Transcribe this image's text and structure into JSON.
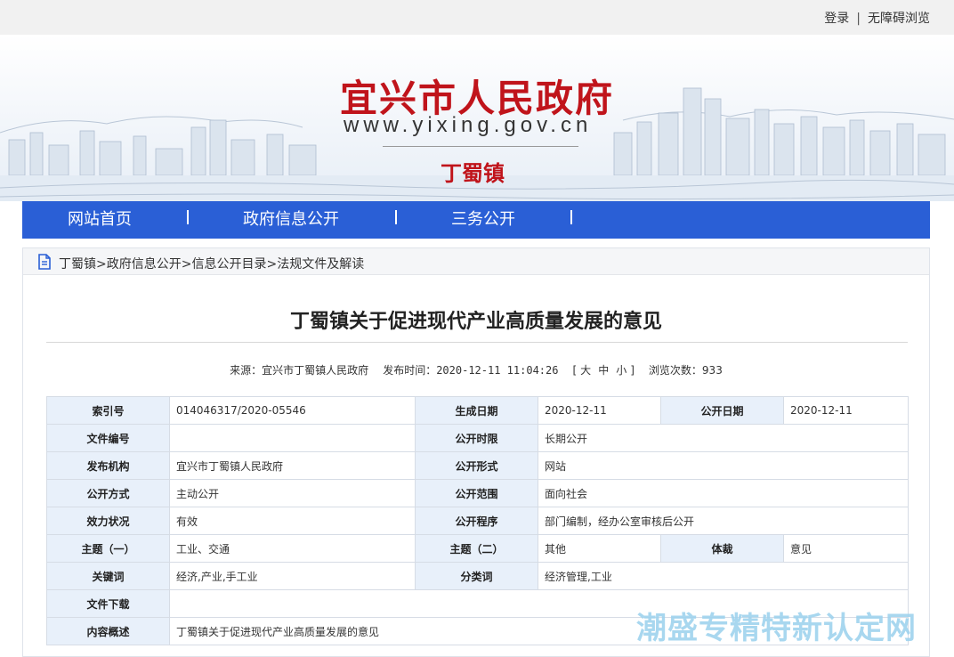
{
  "topbar": {
    "login": "登录",
    "separator": "|",
    "accessibility": "无障碍浏览"
  },
  "banner": {
    "title": "宜兴市人民政府",
    "url": "www.yixing.gov.cn",
    "town": "丁蜀镇"
  },
  "nav": {
    "items": [
      {
        "label": "网站首页"
      },
      {
        "label": "政府信息公开"
      },
      {
        "label": "三务公开"
      }
    ]
  },
  "breadcrumb": {
    "items": [
      "丁蜀镇",
      "政府信息公开",
      "信息公开目录",
      "法规文件及解读"
    ],
    "separator": ">"
  },
  "document": {
    "title": "丁蜀镇关于促进现代产业高质量发展的意见",
    "source_label": "来源：",
    "source": "宜兴市丁蜀镇人民政府",
    "publish_label": "发布时间：",
    "publish_time": "2020-12-11 11:04:26",
    "size_open": "[",
    "size_large": "大",
    "size_medium": "中",
    "size_small": "小",
    "size_close": "]",
    "views_label": "浏览次数：",
    "views": "933"
  },
  "info": {
    "index_no_label": "索引号",
    "index_no": "014046317/2020-05546",
    "gen_date_label": "生成日期",
    "gen_date": "2020-12-11",
    "pub_date_label": "公开日期",
    "pub_date": "2020-12-11",
    "doc_no_label": "文件编号",
    "doc_no": "",
    "pub_limit_label": "公开时限",
    "pub_limit": "长期公开",
    "issuer_label": "发布机构",
    "issuer": "宜兴市丁蜀镇人民政府",
    "pub_form_label": "公开形式",
    "pub_form": "网站",
    "pub_method_label": "公开方式",
    "pub_method": "主动公开",
    "pub_scope_label": "公开范围",
    "pub_scope": "面向社会",
    "validity_label": "效力状况",
    "validity": "有效",
    "pub_proc_label": "公开程序",
    "pub_proc": "部门编制，经办公室审核后公开",
    "topic1_label": "主题（一）",
    "topic1": "工业、交通",
    "topic2_label": "主题（二）",
    "topic2": "其他",
    "genre_label": "体裁",
    "genre": "意见",
    "keywords_label": "关键词",
    "keywords": "经济,产业,手工业",
    "category_label": "分类词",
    "category": "经济管理,工业",
    "download_label": "文件下载",
    "download": "",
    "summary_label": "内容概述",
    "summary": "丁蜀镇关于促进现代产业高质量发展的意见"
  },
  "watermark": "潮盛专精特新认定网",
  "colors": {
    "nav_bg": "#2a5fd6",
    "brand_red": "#c0141b",
    "table_key_bg": "#e8f0fa"
  }
}
